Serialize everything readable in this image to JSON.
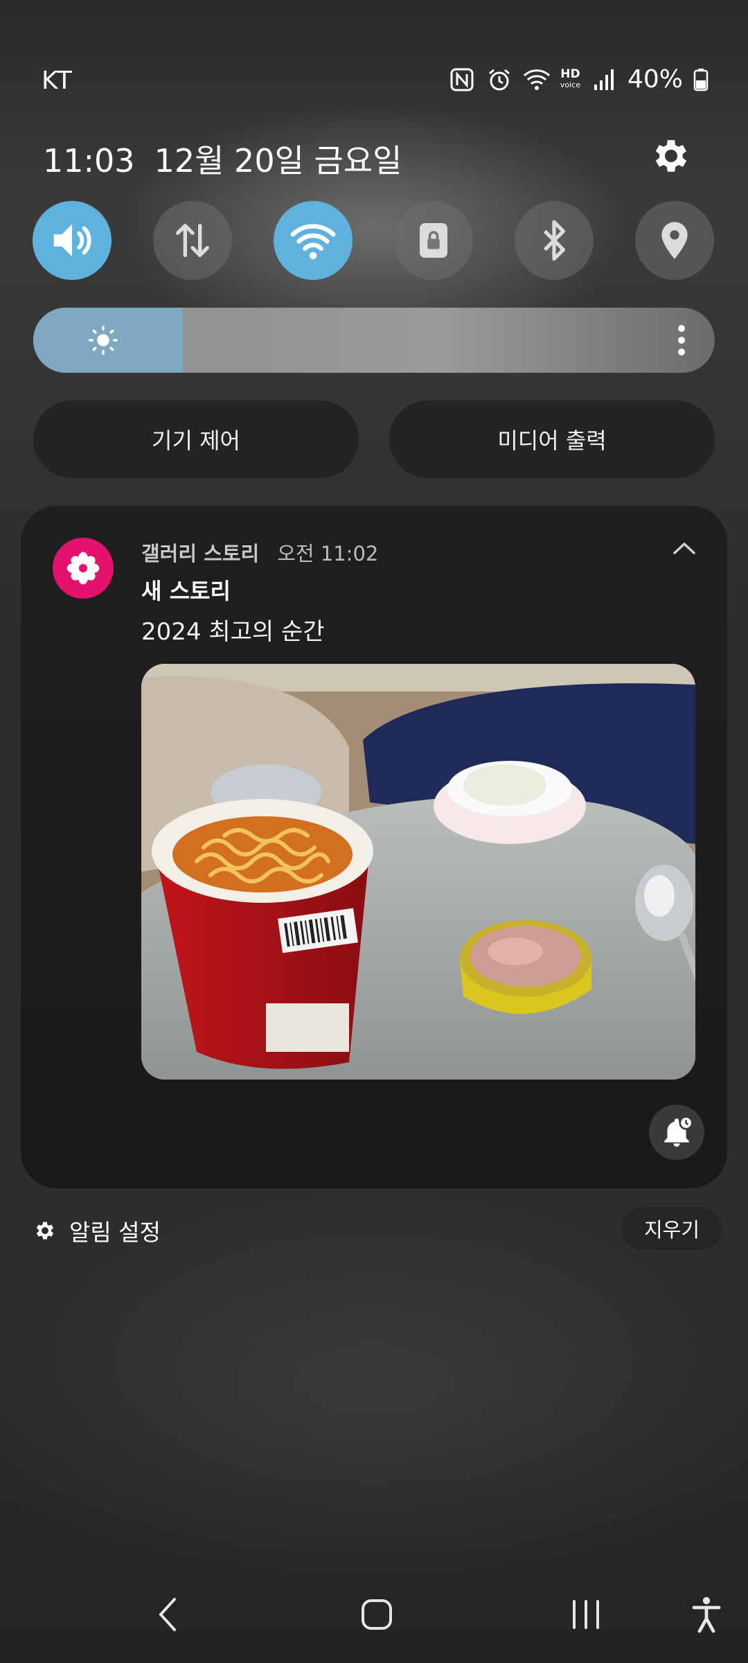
{
  "status_bar": {
    "carrier": "KT",
    "hd_top": "HD",
    "hd_bottom": "voice",
    "battery": "40%"
  },
  "header": {
    "time": "11:03",
    "date": "12월 20일 금요일"
  },
  "quick_buttons": {
    "device_control": "기기 제어",
    "media_output": "미디어 출력"
  },
  "brightness_level": 0.22,
  "notification": {
    "app_name": "갤러리 스토리",
    "time": "오전 11:02",
    "title": "새 스토리",
    "text": "2024 최고의 순간"
  },
  "footer": {
    "settings_label": "알림 설정",
    "clear_label": "지우기"
  },
  "colors": {
    "toggle_on": "#5fb2de",
    "app_icon": "#e4126e"
  }
}
